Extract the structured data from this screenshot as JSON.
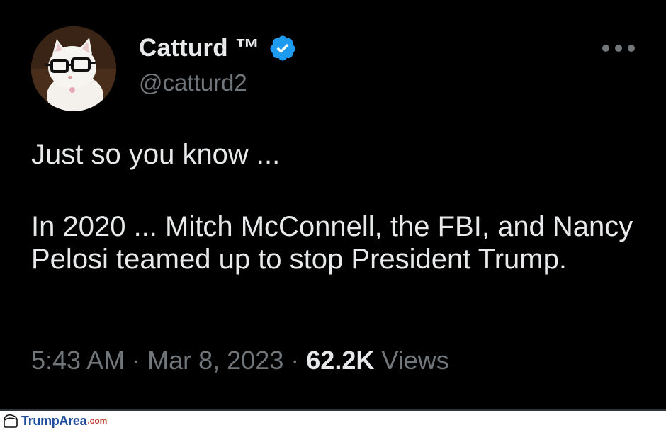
{
  "author": {
    "display_name": "Catturd ™",
    "handle": "@catturd2",
    "verified": true
  },
  "tweet": {
    "paragraphs": [
      "Just so you know ...",
      "In 2020 ... Mitch McConnell, the FBI, and Nancy Pelosi teamed up to stop President Trump."
    ],
    "time": "5:43 AM",
    "separator": "·",
    "date": "Mar 8, 2023",
    "views_count": "62.2K",
    "views_label": "Views"
  },
  "watermark": {
    "brand": "TrumpArea",
    "tld": ".com"
  },
  "colors": {
    "background": "#000000",
    "text": "#e7e9ea",
    "secondary_text": "#71767b",
    "verified_badge": "#1d9bf0",
    "watermark_brand": "#1f4e9c",
    "watermark_tld": "#c0392b"
  },
  "icons": {
    "verified": "verified-badge-icon",
    "more": "more-options-icon",
    "watermark_logo": "trumparea-logo-icon"
  }
}
